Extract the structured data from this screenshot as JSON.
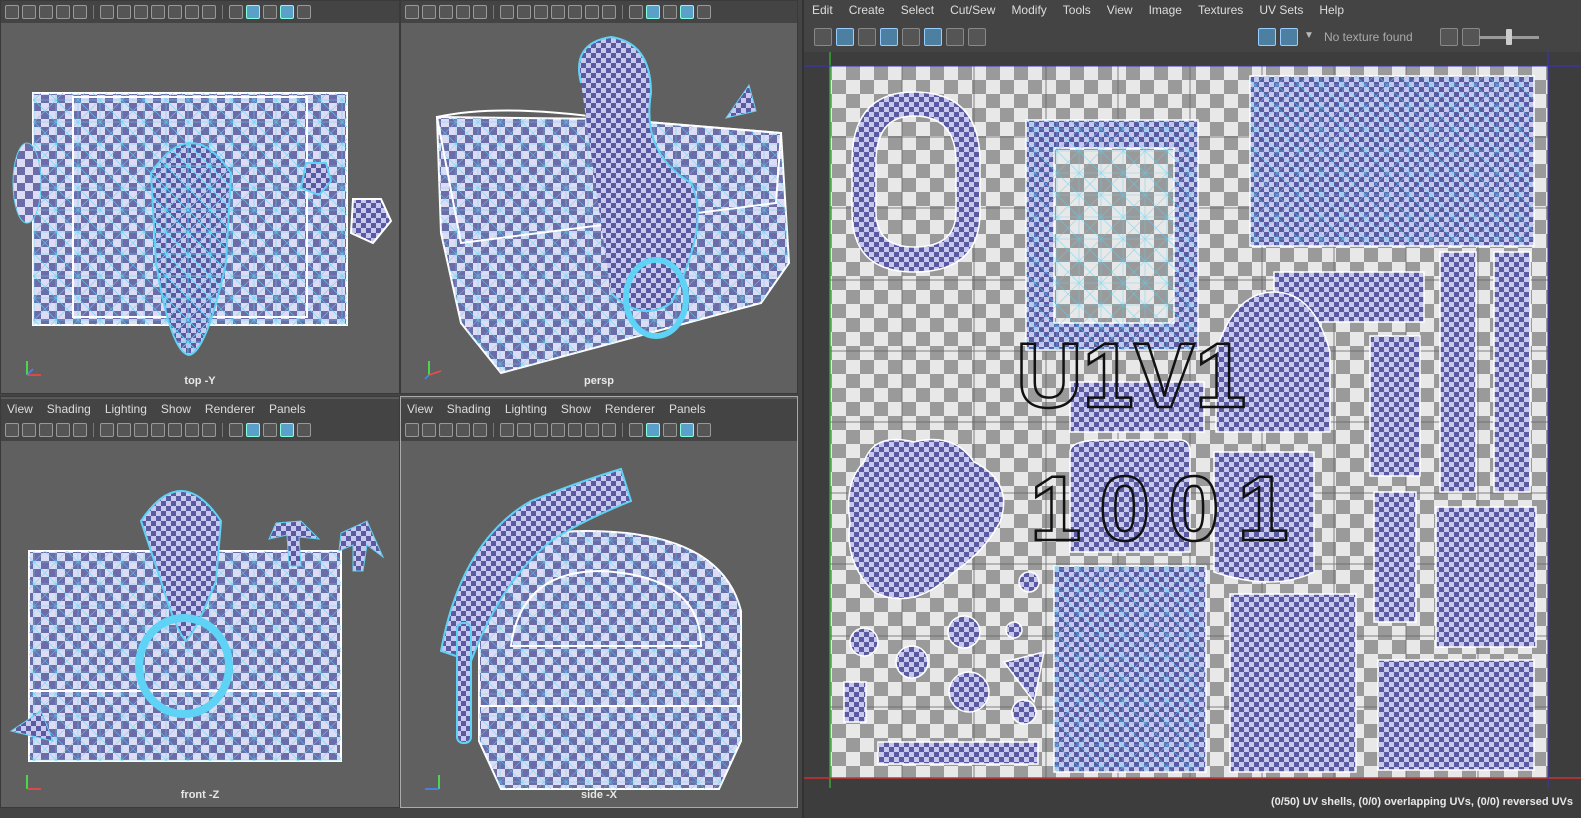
{
  "viewports": {
    "menu": [
      "View",
      "Shading",
      "Lighting",
      "Show",
      "Renderer",
      "Panels"
    ],
    "top": {
      "label": "top -Y"
    },
    "persp": {
      "label": "persp"
    },
    "front": {
      "label": "front -Z"
    },
    "side": {
      "label": "side -X"
    }
  },
  "uv_editor": {
    "menu": [
      "Edit",
      "Create",
      "Select",
      "Cut/Sew",
      "Modify",
      "Tools",
      "View",
      "Image",
      "Textures",
      "UV Sets",
      "Help"
    ],
    "no_texture": "No texture found",
    "tile_text_top": "U1V1",
    "tile_text_bottom": "1001",
    "status": "(0/50) UV shells, (0/0) overlapping UVs, (0/0) reversed UVs"
  },
  "colors": {
    "wire": "#5fd3f5",
    "shell_fill": "#7e7ec8",
    "checker_light": "#d8d8f2",
    "checker_dark": "#6e6ea8"
  }
}
